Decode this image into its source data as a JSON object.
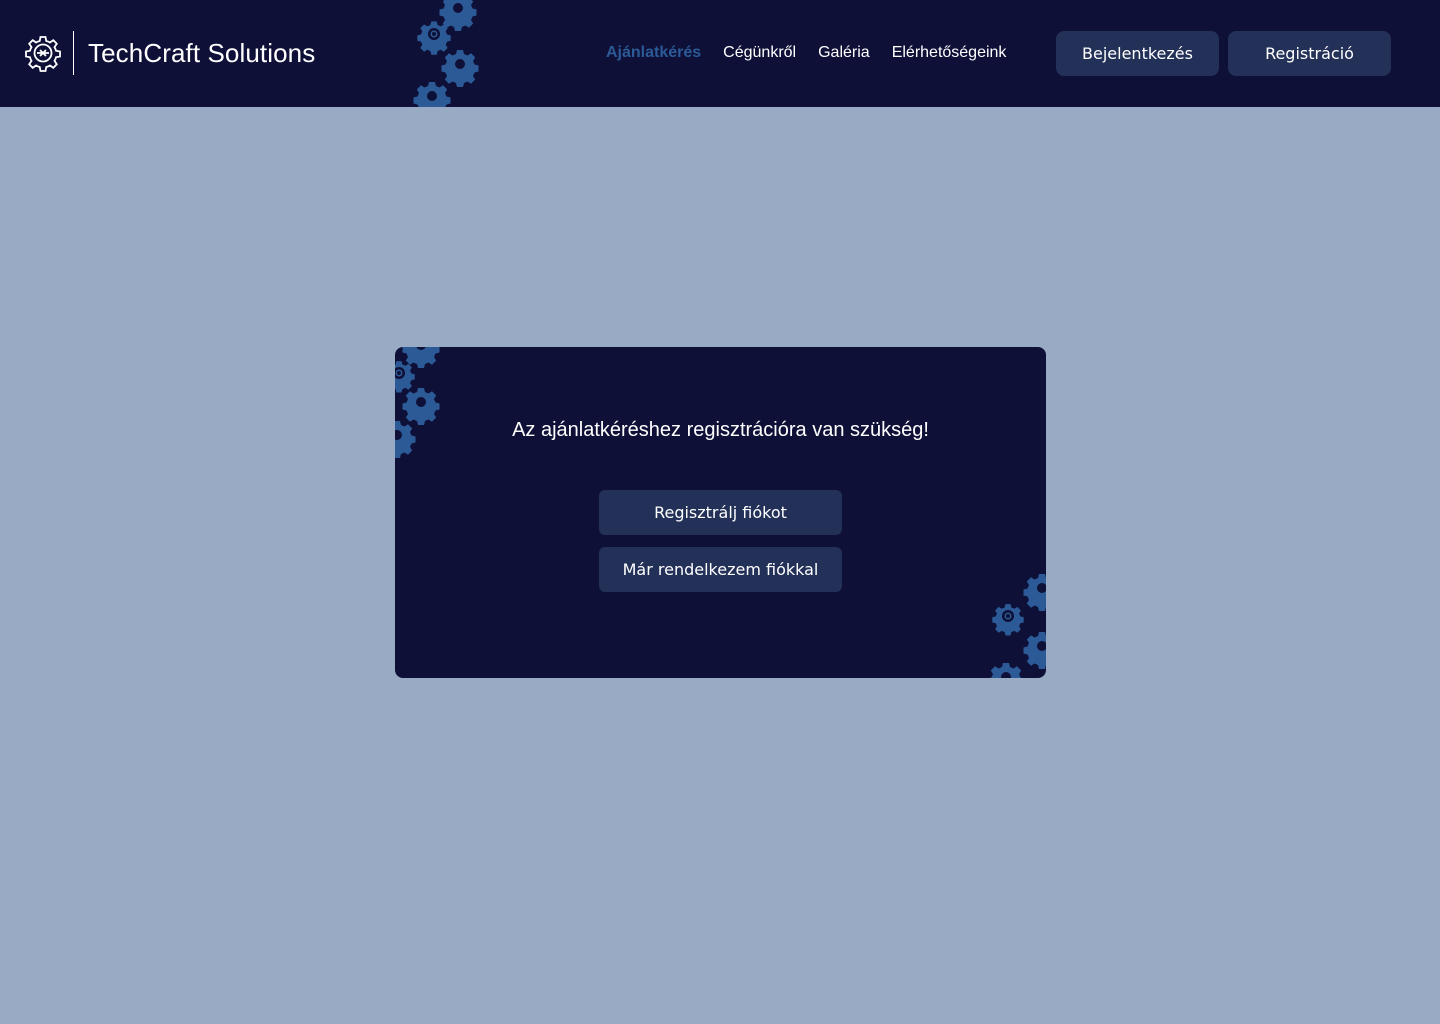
{
  "brand": {
    "name": "TechCraft Solutions",
    "logo_icon": "gear-chip-icon"
  },
  "nav": {
    "items": [
      {
        "label": "Ajánlatkérés",
        "active": true
      },
      {
        "label": "Cégünkről",
        "active": false
      },
      {
        "label": "Galéria",
        "active": false
      },
      {
        "label": "Elérhetőségeink",
        "active": false
      }
    ]
  },
  "auth": {
    "login_label": "Bejelentkezés",
    "register_label": "Registráció"
  },
  "notice": {
    "message": "Az ajánlatkéréshez regisztrációra van szükség!",
    "register_button": "Regisztrálj fiókot",
    "login_button": "Már rendelkezem fiókkal"
  },
  "colors": {
    "background": "#99aac4",
    "header_bg": "#0e1037",
    "card_bg": "#0e1037",
    "button_bg": "#233058",
    "active_nav": "#2c5a97",
    "gear_accent": "#2c5a97",
    "text": "#ffffff"
  }
}
